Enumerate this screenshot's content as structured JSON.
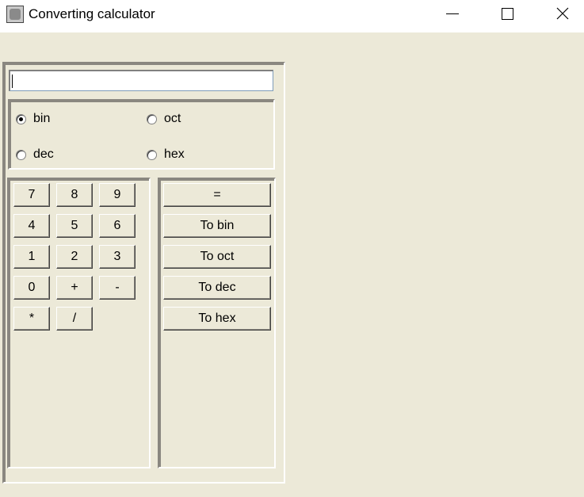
{
  "window": {
    "title": "Converting calculator",
    "controls": {
      "minimize": "—",
      "maximize": "☐",
      "close": "✕"
    }
  },
  "display": {
    "value": ""
  },
  "base_options": [
    {
      "label": "bin",
      "checked": true
    },
    {
      "label": "oct",
      "checked": false
    },
    {
      "label": "dec",
      "checked": false
    },
    {
      "label": "hex",
      "checked": false
    }
  ],
  "keypad": {
    "k7": "7",
    "k8": "8",
    "k9": "9",
    "k4": "4",
    "k5": "5",
    "k6": "6",
    "k1": "1",
    "k2": "2",
    "k3": "3",
    "k0": "0",
    "plus": "+",
    "minus": "-",
    "mul": "*",
    "div": "/"
  },
  "actions": {
    "equals": "=",
    "to_bin": "To bin",
    "to_oct": "To oct",
    "to_dec": "To dec",
    "to_hex": "To hex"
  },
  "colors": {
    "face": "#ece9d8",
    "window_bg": "#ffffff"
  }
}
